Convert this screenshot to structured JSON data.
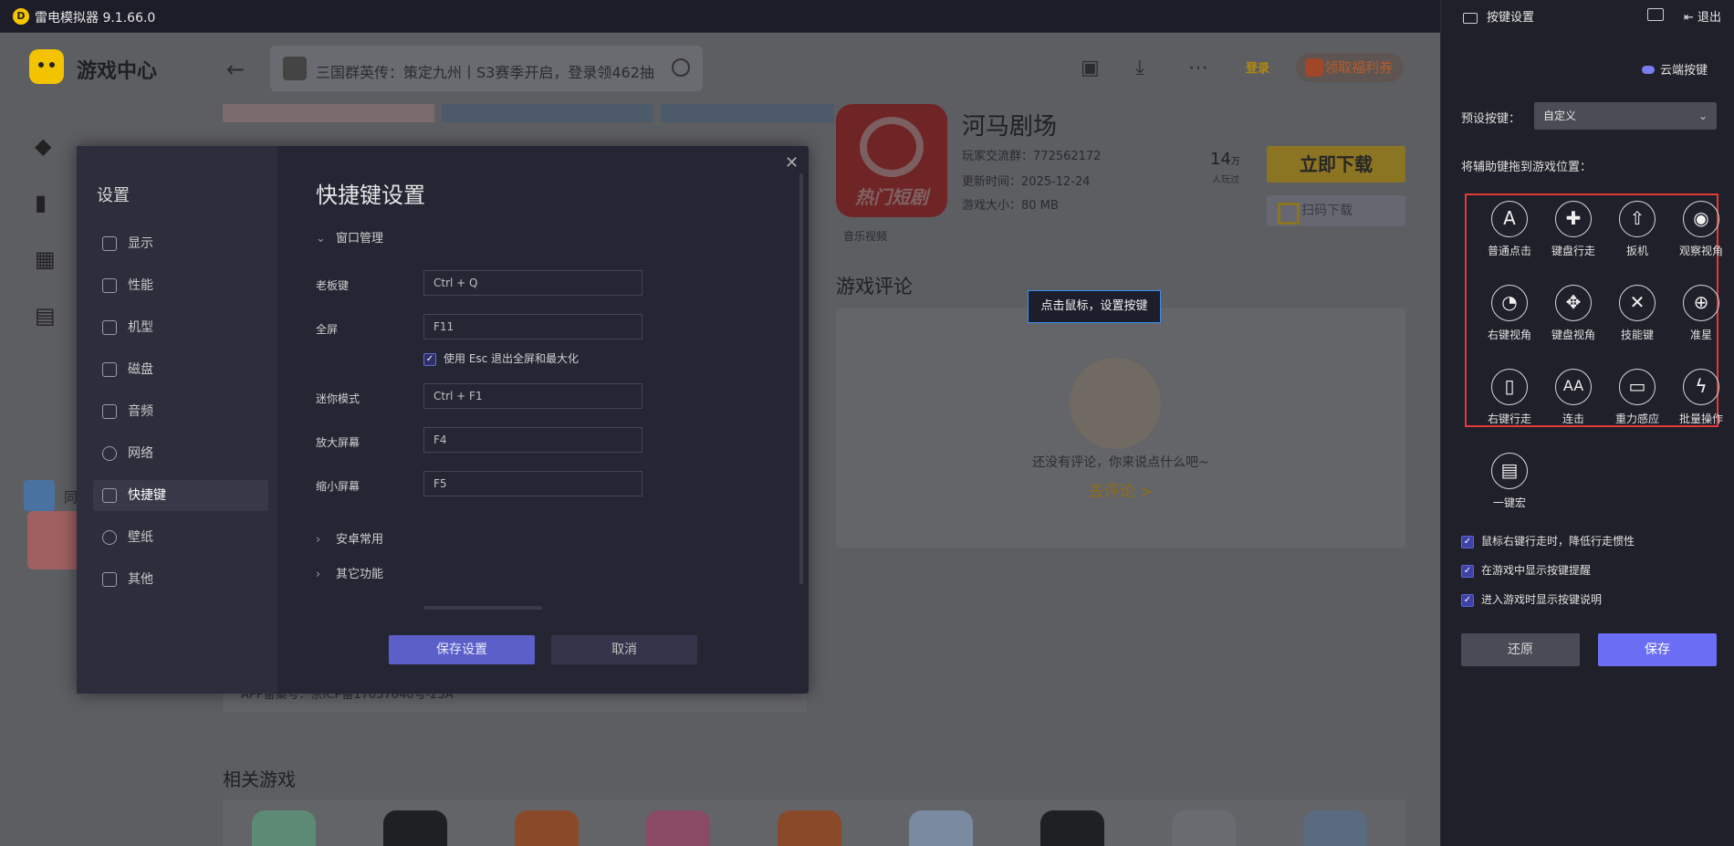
{
  "window": {
    "title": "雷电模拟器 9.1.66.0"
  },
  "game_center": {
    "title": "游戏中心",
    "search_text": "三国群英传：策定九州丨S3赛季开启，登录领462抽",
    "login": "登录",
    "welfare": "领取福利券",
    "side_item": "同"
  },
  "app": {
    "name": "河马剧场",
    "icon_label": "热门短剧",
    "group": "玩家交流群：772562172",
    "updated": "更新时间：2025-12-24",
    "size": "游戏大小：80 MB",
    "tag": "音乐视频",
    "player_count": "14",
    "player_unit": "万",
    "player_sub": "人玩过",
    "download": "立即下载",
    "scan_download": "扫码下载"
  },
  "comments": {
    "title": "游戏评论",
    "empty": "还没有评论，你来说点什么吧~",
    "go": "去评论 >"
  },
  "icp": "APP备案号：京ICP备17057640号-25A",
  "related_title": "相关游戏",
  "tooltip": "点击鼠标，设置按键",
  "settings_dialog": {
    "title": "设置",
    "nav": [
      {
        "label": "显示"
      },
      {
        "label": "性能"
      },
      {
        "label": "机型"
      },
      {
        "label": "磁盘"
      },
      {
        "label": "音频"
      },
      {
        "label": "网络"
      },
      {
        "label": "快捷键",
        "active": true
      },
      {
        "label": "壁纸"
      },
      {
        "label": "其他"
      }
    ],
    "section_title": "快捷键设置",
    "group_window": "窗口管理",
    "rows": [
      {
        "label": "老板键",
        "value": "Ctrl + Q"
      },
      {
        "label": "全屏",
        "value": "F11"
      },
      {
        "label": "迷你模式",
        "value": "Ctrl + F1"
      },
      {
        "label": "放大屏幕",
        "value": "F4"
      },
      {
        "label": "缩小屏幕",
        "value": "F5"
      }
    ],
    "esc_option": "使用 Esc 退出全屏和最大化",
    "group_android": "安卓常用",
    "group_other": "其它功能",
    "save": "保存设置",
    "cancel": "取消"
  },
  "key_panel": {
    "title": "按键设置",
    "exit": "退出",
    "cloud": "云端按键",
    "preset_label": "预设按键：",
    "preset_value": "自定义",
    "drag_hint": "将辅助键拖到游戏位置：",
    "keys": [
      {
        "label": "普通点击",
        "glyph": "A"
      },
      {
        "label": "键盘行走",
        "glyph": "✚"
      },
      {
        "label": "扳机",
        "glyph": "⇧"
      },
      {
        "label": "观察视角",
        "glyph": "◉"
      },
      {
        "label": "右键视角",
        "glyph": "◔"
      },
      {
        "label": "键盘视角",
        "glyph": "✥"
      },
      {
        "label": "技能键",
        "glyph": "✕"
      },
      {
        "label": "准星",
        "glyph": "⊕"
      },
      {
        "label": "右键行走",
        "glyph": "▯"
      },
      {
        "label": "连击",
        "glyph": "AA"
      },
      {
        "label": "重力感应",
        "glyph": "▭"
      },
      {
        "label": "批量操作",
        "glyph": "ϟ"
      },
      {
        "label": "一键宏",
        "glyph": "▤"
      }
    ],
    "options": [
      "鼠标右键行走时，降低行走惯性",
      "在游戏中显示按键提醒",
      "进入游戏时显示按键说明"
    ],
    "restore": "还原",
    "save": "保存"
  }
}
